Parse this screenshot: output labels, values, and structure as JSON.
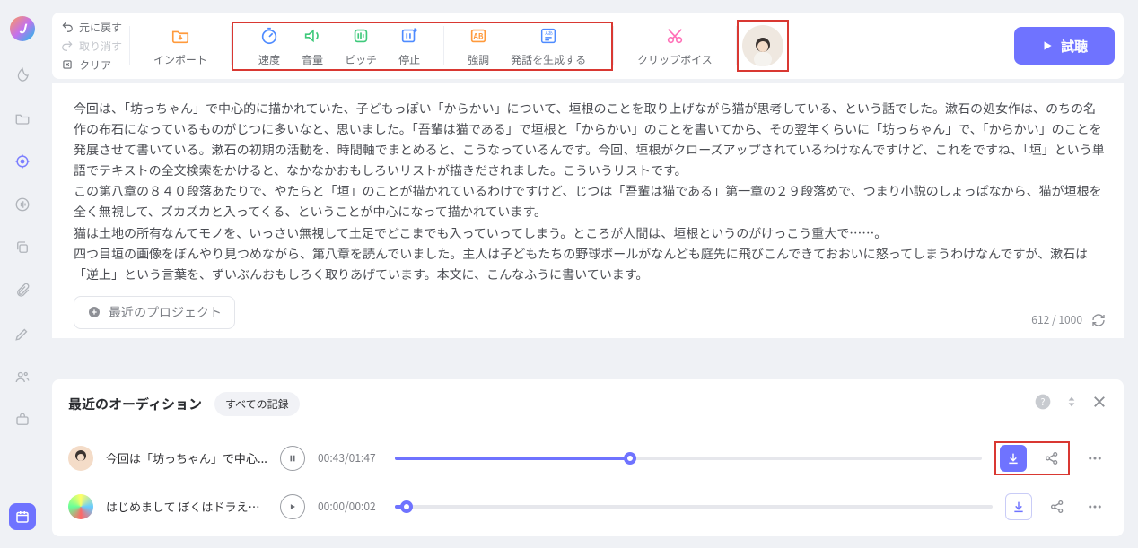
{
  "history": {
    "undo": "元に戻す",
    "redo": "取り消す",
    "clear": "クリア"
  },
  "toolbar": {
    "import": "インポート",
    "speed": "速度",
    "volume": "音量",
    "pitch": "ピッチ",
    "pause": "停止",
    "emphasis": "強調",
    "generate": "発話を生成する",
    "clipvoice": "クリップボイス",
    "preview": "試聴"
  },
  "text_body": [
    "今回は、「坊っちゃん」で中心的に描かれていた、子どもっぽい「からかい」について、垣根のことを取り上げながら猫が思考している、という話でした。漱石の処女作は、のちの名作の布石になっているものがじつに多いなと、思いました。「吾輩は猫である」で垣根と「からかい」のことを書いてから、その翌年くらいに「坊っちゃん」で、「からかい」のことを発展させて書いている。漱石の初期の活動を、時間軸でまとめると、こうなっているんです。今回、垣根がクローズアップされているわけなんですけど、これをですね、「垣」という単語でテキストの全文検索をかけると、なかなかおもしろいリストが描きだされました。こういうリストです。",
    "この第八章の８４０段落あたりで、やたらと「垣」のことが描かれているわけですけど、じつは「吾輩は猫である」第一章の２９段落めで、つまり小説のしょっぱなから、猫が垣根を全く無視して、ズカズカと入ってくる、ということが中心になって描かれています。",
    "猫は土地の所有なんてモノを、いっさい無視して土足でどこまでも入っていってしまう。ところが人間は、垣根というのがけっこう重大で……。",
    "四つ目垣の画像をぼんやり見つめながら、第八章を読んでいました。主人は子どもたちの野球ボールがなんども庭先に飛びこんできておおいに怒ってしまうわけなんですが、漱石は「逆上」という言葉を、ずいぶんおもしろく取りあげています。本文に、こんなふうに書いています。"
  ],
  "recent_projects_btn": "最近のプロジェクト",
  "counter": {
    "current": "612",
    "sep": " / ",
    "max": "1000"
  },
  "audition": {
    "title": "最近のオーディション",
    "all_label": "すべての記録",
    "tracks": [
      {
        "title": "今回は「坊っちゃん」で中心...",
        "time": "00:43/01:47",
        "progress_pct": 40,
        "state": "paused",
        "avatar": "person"
      },
      {
        "title": "はじめまして ぼくはドラえも...",
        "time": "00:00/00:02",
        "progress_pct": 2,
        "state": "stopped",
        "avatar": "color"
      }
    ]
  }
}
